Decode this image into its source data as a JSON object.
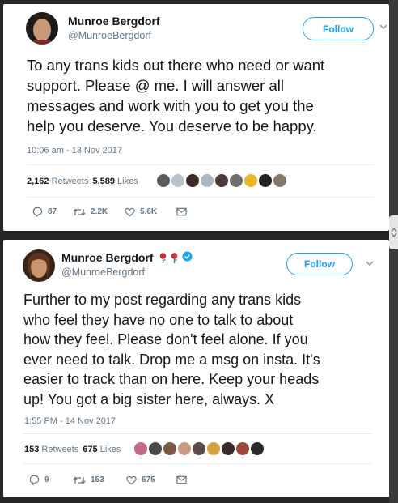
{
  "tweets": [
    {
      "name": "Munroe Bergdorf",
      "handle": "@MunroeBergdorf",
      "follow_label": "Follow",
      "text_lines": [
        "To any trans kids out there who need or want",
        "support. Please @ me. I will answer all",
        "messages and work with you to get you the",
        "help you deserve. You deserve to be happy."
      ],
      "timestamp": "10:06 am - 13 Nov 2017",
      "retweets_count": "2,162",
      "retweets_label": "Retweets",
      "likes_count": "5,589",
      "likes_label": "Likes",
      "replies": "87",
      "retweets_short": "2.2K",
      "likes_short": "5.6K",
      "verified": false
    },
    {
      "name": "Munroe Bergdorf",
      "handle": "@MunroeBergdorf",
      "follow_label": "Follow",
      "text_lines": [
        "Further to my post regarding any trans kids",
        "who feel they have no one to talk to about",
        "how they feel. Please don't feel alone. If you",
        "ever need to talk. Drop me a msg on insta. It's",
        "easier to track than on here. Keep your heads",
        "up! You got a big sister here, always. X"
      ],
      "timestamp": "1:55 PM - 14 Nov 2017",
      "retweets_count": "153",
      "retweets_label": "Retweets",
      "likes_count": "675",
      "likes_label": "Likes",
      "replies": "9",
      "retweets_short": "153",
      "likes_short": "675",
      "verified": true
    }
  ],
  "colors": {
    "accent": "#1da1f2",
    "muted": "#657786",
    "text": "#14171a"
  }
}
